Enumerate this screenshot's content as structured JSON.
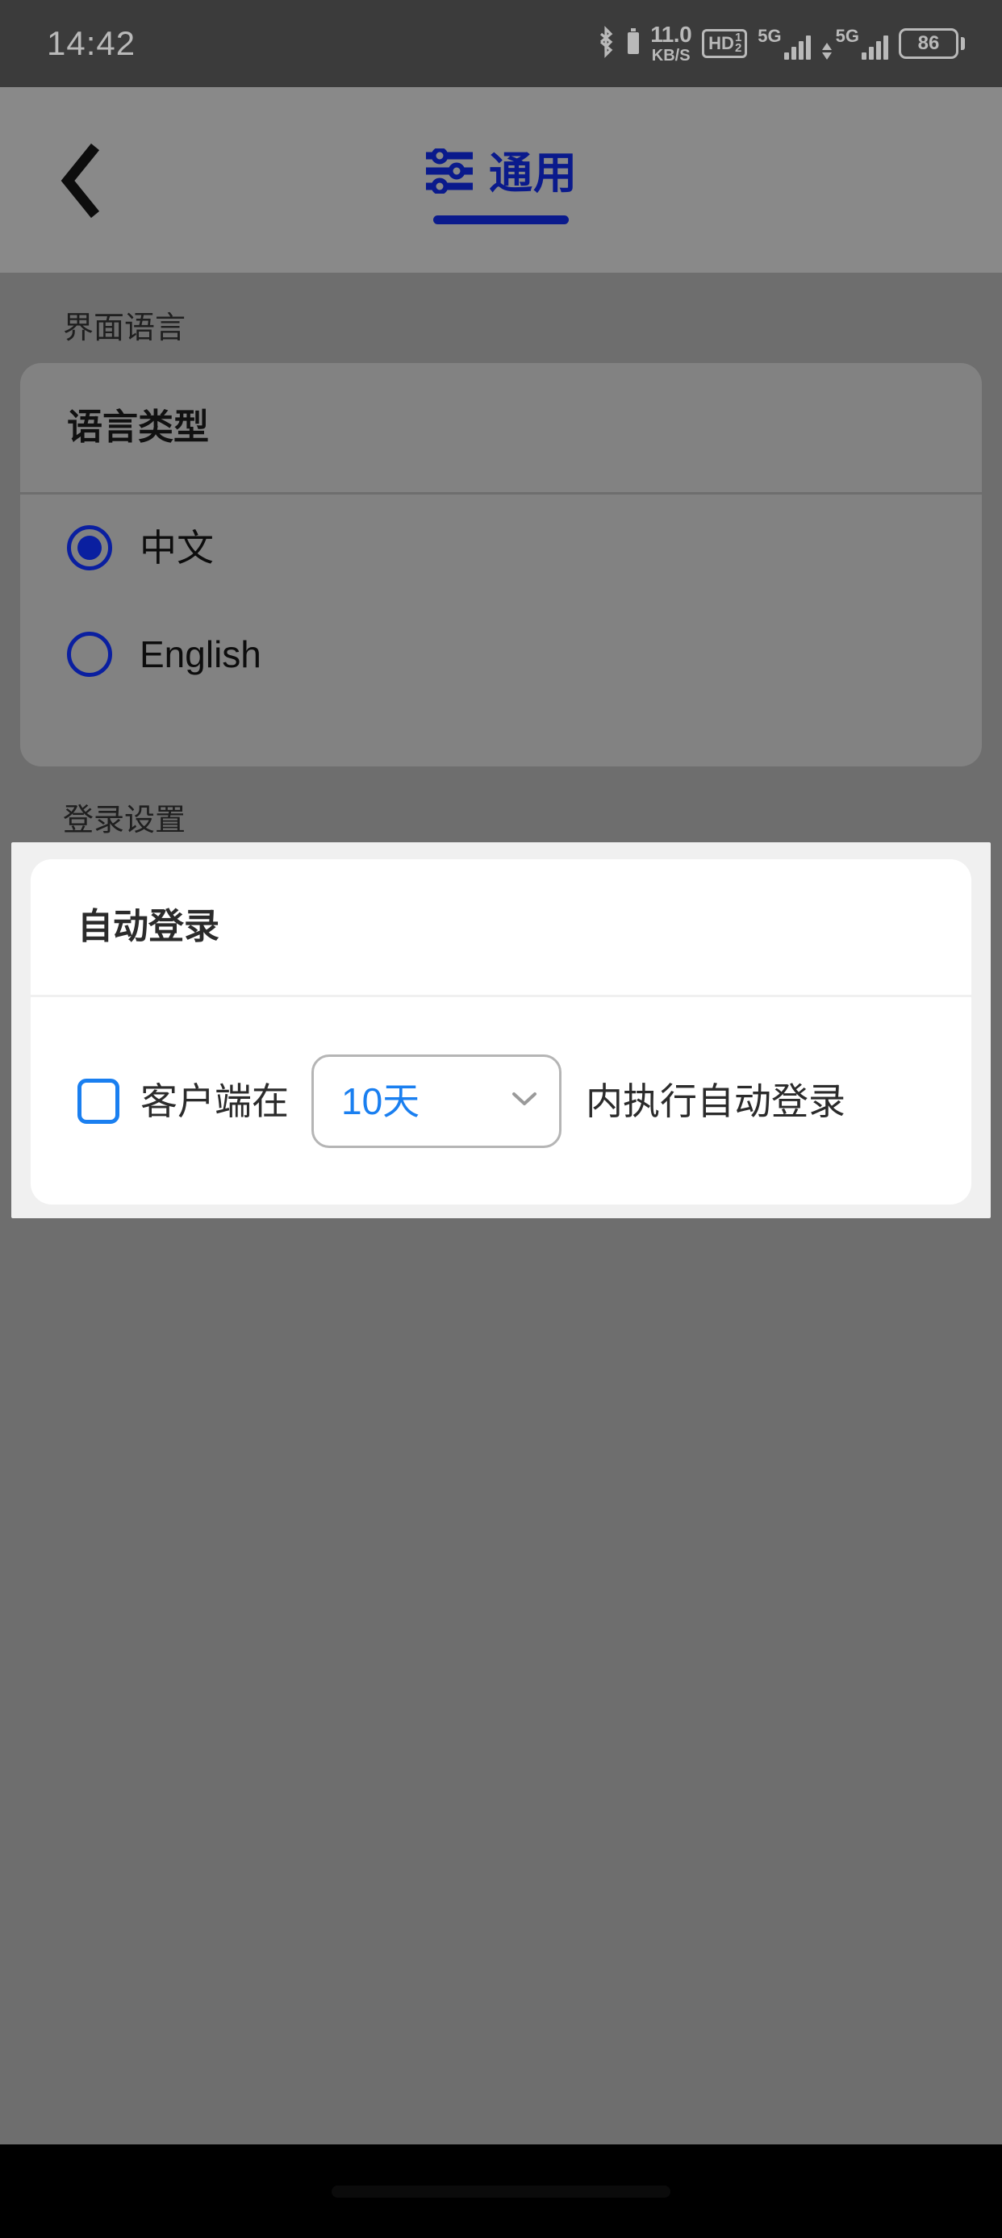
{
  "status_bar": {
    "clock": "14:42",
    "bluetooth_icon": "bluetooth-icon",
    "net_speed_rate": "11.0",
    "net_speed_unit": "KB/S",
    "hd_label": "HD",
    "hd_sup": "1",
    "hd_sub": "2",
    "sim1_network": "5G",
    "sim2_network": "5G",
    "battery_level": "86"
  },
  "header": {
    "back_icon": "chevron-left-icon",
    "settings_icon": "sliders-icon",
    "title": "通用"
  },
  "content": {
    "interface_language": {
      "section_label": "界面语言",
      "card_title": "语言类型",
      "options": [
        {
          "label": "中文",
          "selected": true
        },
        {
          "label": "English",
          "selected": false
        }
      ]
    },
    "login_settings": {
      "section_label": "登录设置",
      "card_title": "自动登录",
      "checkbox_checked": false,
      "text_before": "客户端在",
      "select_value": "10天",
      "select_chevron_icon": "chevron-down-icon",
      "text_after": "内执行自动登录"
    }
  },
  "colors": {
    "accent_dark_blue": "#0a1fa0",
    "accent_link_blue": "#1a7ff0",
    "dim_overlay_bg": "#6e6e6e",
    "card_dim_bg": "#828282",
    "highlight_bg": "#f0f0f0",
    "card_bg": "#ffffff",
    "status_bar_bg": "#3b3b3b",
    "nav_bar_bg": "#000000"
  }
}
